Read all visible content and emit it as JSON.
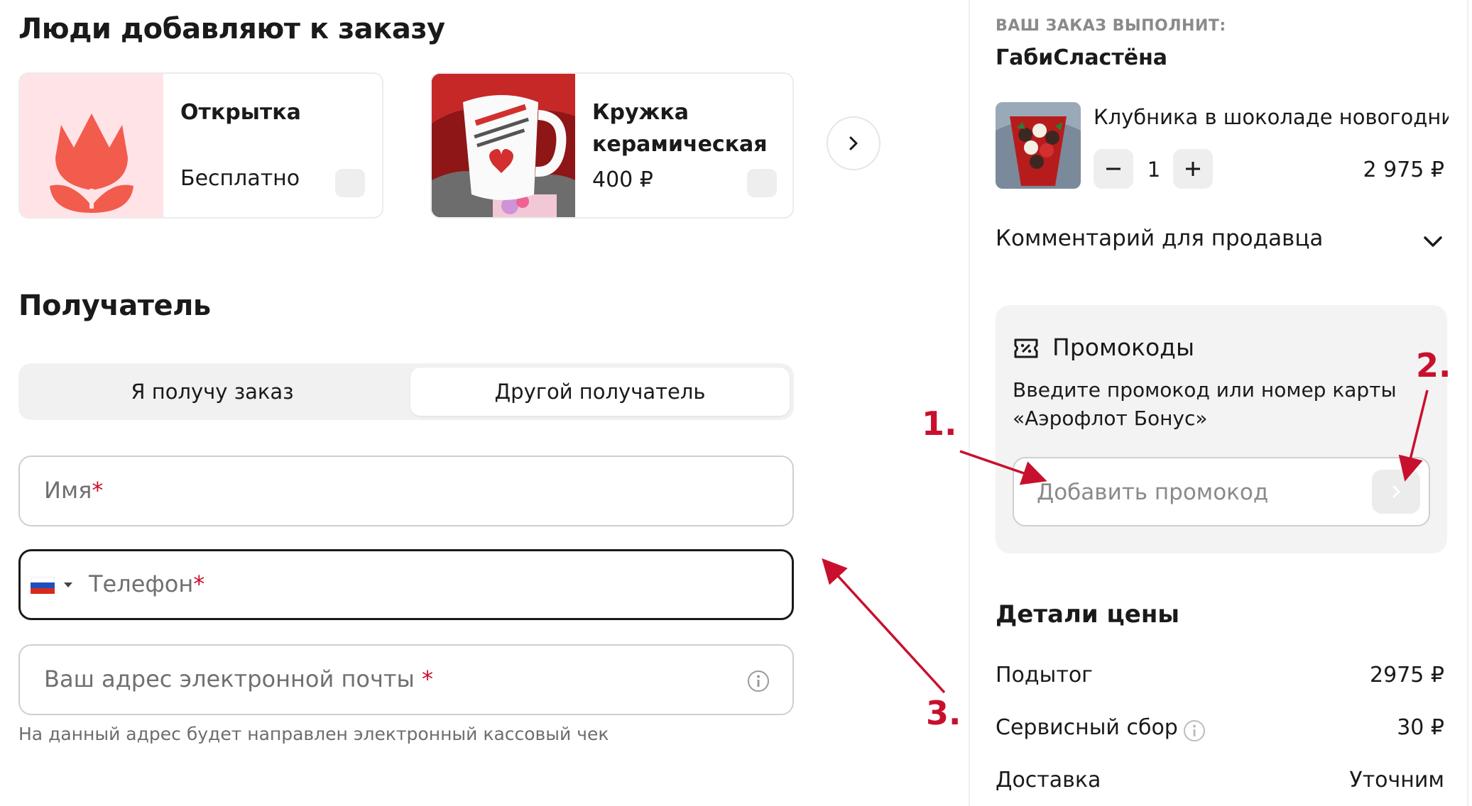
{
  "addons": {
    "title": "Люди добавляют к заказу",
    "items": [
      {
        "name": "Открытка",
        "price": "Бесплатно"
      },
      {
        "name": "Кружка керамическая",
        "price": "400 ₽"
      }
    ]
  },
  "recipient": {
    "title": "Получатель",
    "tabs": [
      "Я получу заказ",
      "Другой получатель"
    ],
    "active_tab": "Другой получатель",
    "name_placeholder": "Имя",
    "phone_placeholder": "Телефон",
    "email_placeholder": "Ваш адрес электронной почты",
    "required_mark": "*",
    "email_hint": "На данный адрес будет направлен электронный кассовый чек"
  },
  "order": {
    "fulfilled_by_label": "ВАШ ЗАКАЗ ВЫПОЛНИТ:",
    "seller": "ГабиСластёна",
    "item": {
      "name": "Клубника в шоколаде новогодний \"",
      "quantity": "1",
      "price": "2 975 ₽"
    },
    "comment_label": "Комментарий для продавца",
    "promo": {
      "title": "Промокоды",
      "description": "Введите промокод или номер карты «Аэрофлот Бонус»",
      "placeholder": "Добавить промокод"
    },
    "price_details": {
      "title": "Детали цены",
      "rows": [
        {
          "label": "Подытог",
          "value": "2975 ₽"
        },
        {
          "label": "Сервисный сбор",
          "value": "30 ₽"
        },
        {
          "label": "Доставка",
          "value": "Уточним"
        }
      ]
    }
  },
  "annotations": [
    "1.",
    "2.",
    "3."
  ],
  "colors": {
    "accent": "#c8102e",
    "tulip": "#f25c4d",
    "tulip_bg": "#ffe3e6",
    "field_border": "#cfcfcf",
    "muted_text": "#707070"
  },
  "icons": [
    "tulip-icon",
    "chevron-right-icon",
    "russia-flag-icon",
    "caret-down-icon",
    "info-icon",
    "minus-icon",
    "plus-icon",
    "chevron-down-icon",
    "coupon-icon"
  ]
}
